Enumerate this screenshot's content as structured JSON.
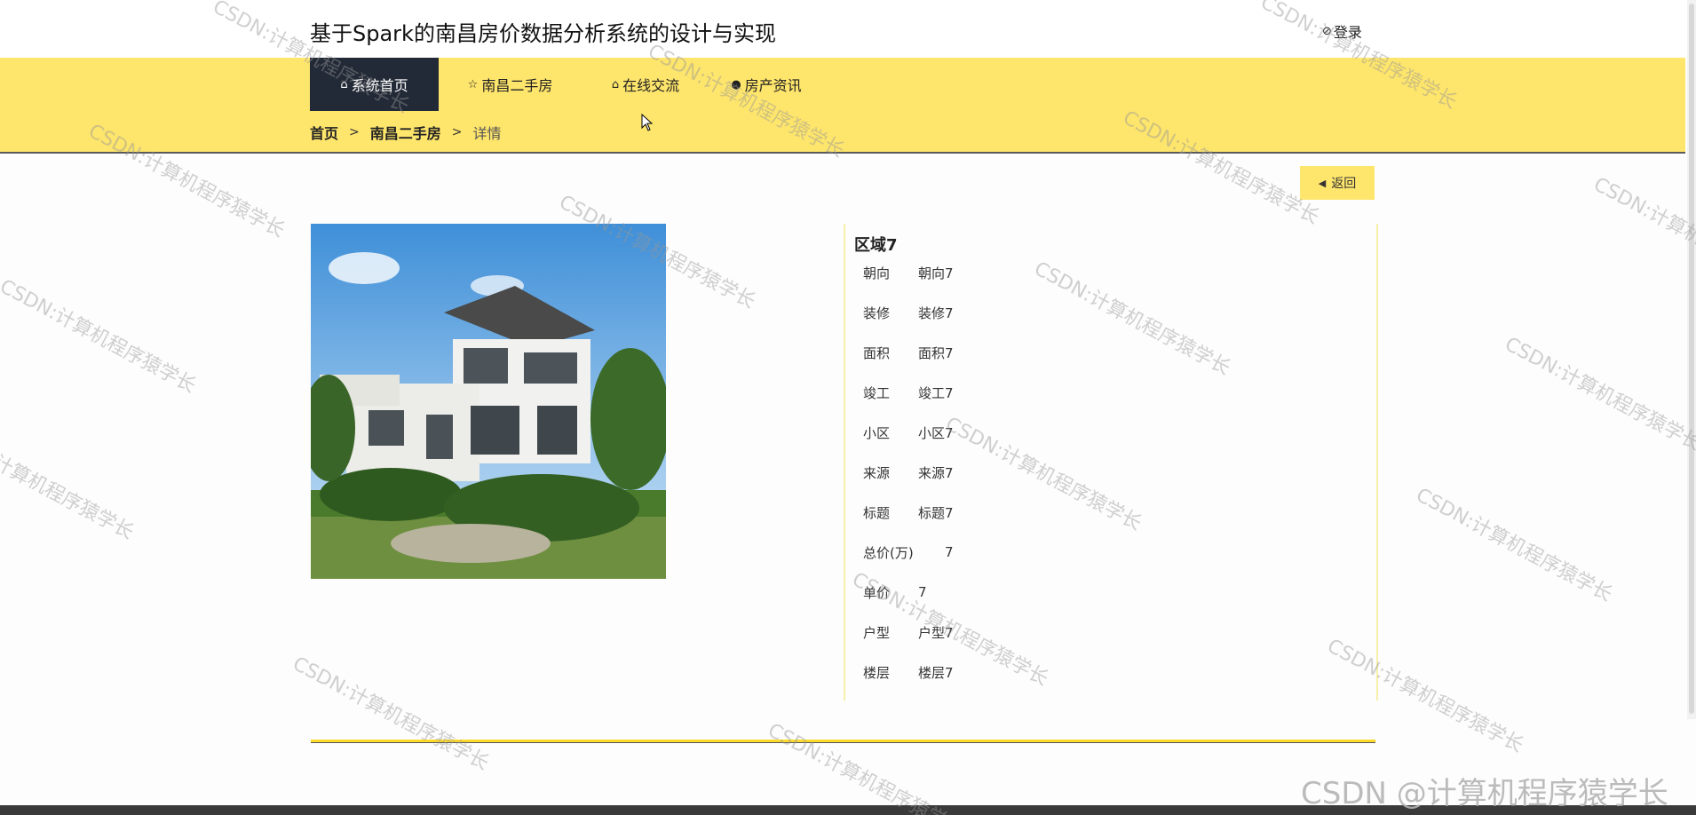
{
  "header": {
    "site_title": "基于Spark的南昌房价数据分析系统的设计与实现",
    "login_label": "登录"
  },
  "nav": {
    "items": [
      {
        "label": "系统首页",
        "icon": "home-icon",
        "active": true
      },
      {
        "label": "南昌二手房",
        "icon": "star-icon",
        "active": false
      },
      {
        "label": "在线交流",
        "icon": "bag-icon",
        "active": false
      },
      {
        "label": "房产资讯",
        "icon": "info-icon",
        "active": false
      }
    ]
  },
  "breadcrumb": {
    "home": "首页",
    "section": "南昌二手房",
    "current": "详情",
    "separator": ">"
  },
  "back_button": {
    "label": "返回"
  },
  "detail": {
    "title": "区域7",
    "fields": [
      {
        "label": "朝向",
        "value": "朝向7"
      },
      {
        "label": "装修",
        "value": "装修7"
      },
      {
        "label": "面积",
        "value": "面积7"
      },
      {
        "label": "竣工",
        "value": "竣工7"
      },
      {
        "label": "小区",
        "value": "小区7"
      },
      {
        "label": "来源",
        "value": "来源7"
      },
      {
        "label": "标题",
        "value": "标题7"
      },
      {
        "label": "总价(万)",
        "value": "7"
      },
      {
        "label": "单价",
        "value": "7"
      },
      {
        "label": "户型",
        "value": "户型7"
      },
      {
        "label": "楼层",
        "value": "楼层7"
      }
    ]
  },
  "watermark": {
    "text": "CSDN:计算机程序猿学长",
    "corner_text": "CSDN @计算机程序猿学长"
  },
  "colors": {
    "nav_bg": "#fee56c",
    "nav_active_bg": "#232a37",
    "accent_line": "#fcd92a"
  }
}
